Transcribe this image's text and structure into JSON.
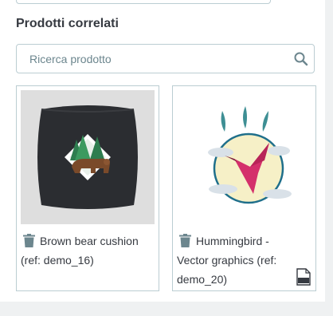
{
  "section": {
    "title": "Prodotti correlati"
  },
  "search": {
    "placeholder": "Ricerca prodotto",
    "value": "",
    "icon": "search-icon"
  },
  "products": [
    {
      "name": "Brown bear cushion",
      "ref": "(ref: demo_16)",
      "delete_icon": "trash-icon",
      "thumbnail": "bear-cushion-image"
    },
    {
      "name": "Hummingbird -",
      "name_line2": "Vector graphics",
      "ref": "(ref:",
      "ref_line2": "demo_20)",
      "delete_icon": "trash-icon",
      "thumbnail": "hummingbird-image",
      "badge": "svg-file-icon"
    }
  ],
  "colors": {
    "border": "#bbcdd2",
    "text": "#363a41",
    "placeholder": "#6c868e",
    "gutter": "#eff1f2",
    "cushion": "#2b2d31",
    "hummingbird": "#d4306b"
  }
}
